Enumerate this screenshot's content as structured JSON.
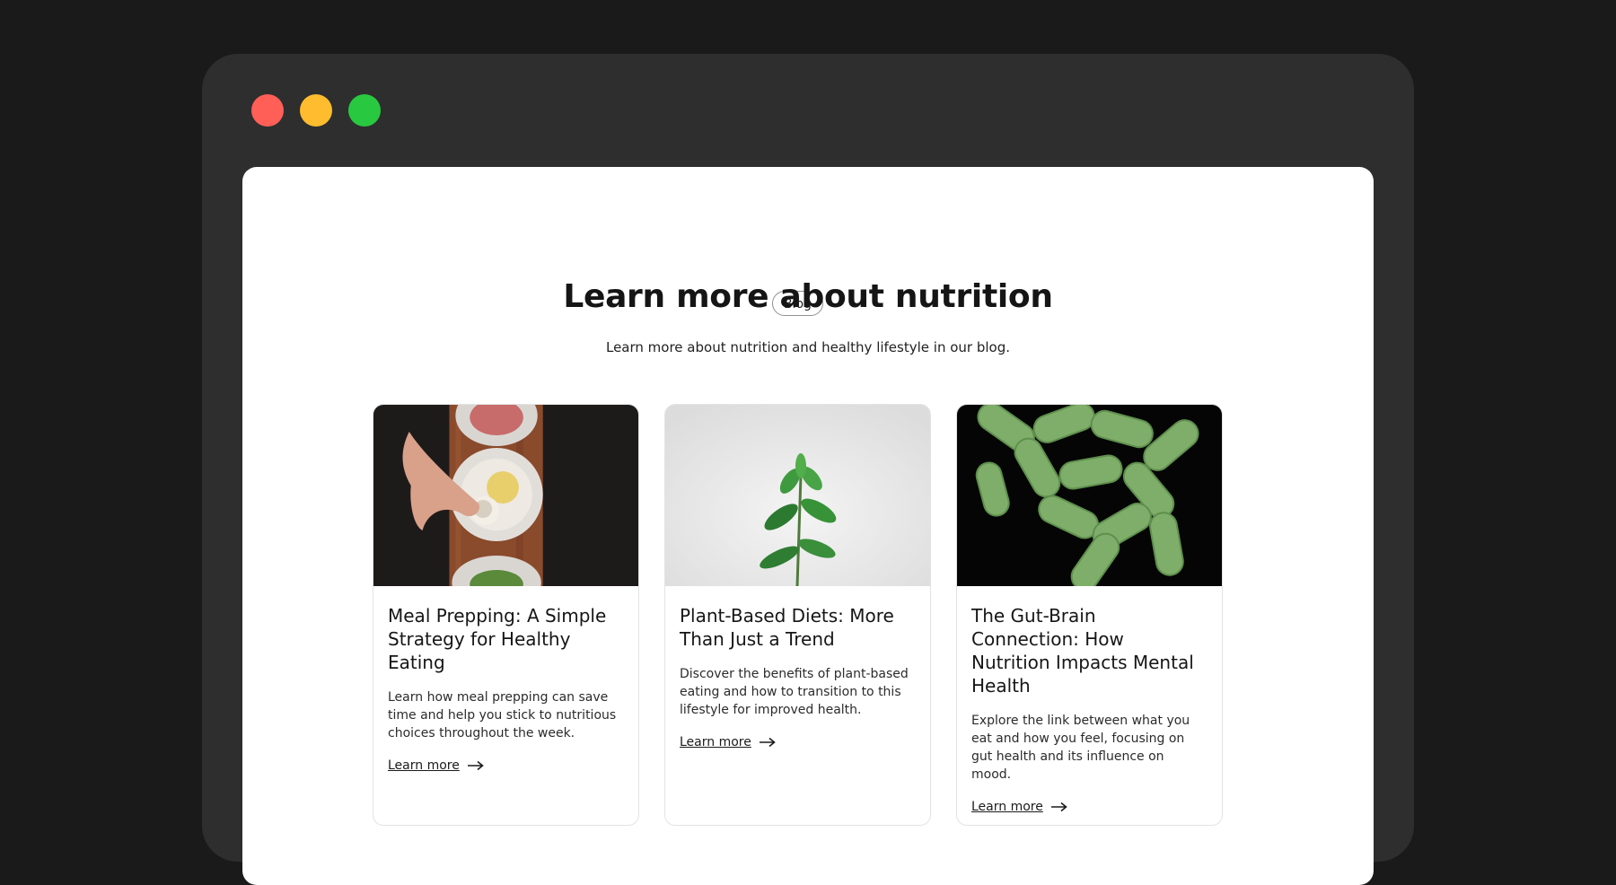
{
  "blog": {
    "badge": "Blog",
    "heading": "Learn more about nutrition",
    "subheading": "Learn more about nutrition and healthy lifestyle in our blog."
  },
  "cards": [
    {
      "title": "Meal Prepping: A Simple Strategy for Healthy Eating",
      "excerpt": "Learn how meal prepping can save time and help you stick to nutritious choices throughout the week.",
      "link": "Learn more",
      "image": "meal-prep-photo"
    },
    {
      "title": "Plant-Based Diets: More Than Just a Trend",
      "excerpt": "Discover the benefits of plant-based eating and how to transition to this lifestyle for improved health.",
      "link": "Learn more",
      "image": "plant-photo"
    },
    {
      "title": "The Gut-Brain Connection: How Nutrition Impacts Mental Health",
      "excerpt": "Explore the link between what you eat and how you feel, focusing on gut health and its influence on mood.",
      "link": "Learn more",
      "image": "probiotic-bacteria-photo"
    }
  ],
  "icons": {
    "link_arrow": "arrow-right-icon"
  },
  "colors": {
    "background": "#1a1a1a",
    "window": "#2e2e2e",
    "traffic_red": "#ff5f57",
    "traffic_yellow": "#febc2e",
    "traffic_green": "#28c840"
  }
}
